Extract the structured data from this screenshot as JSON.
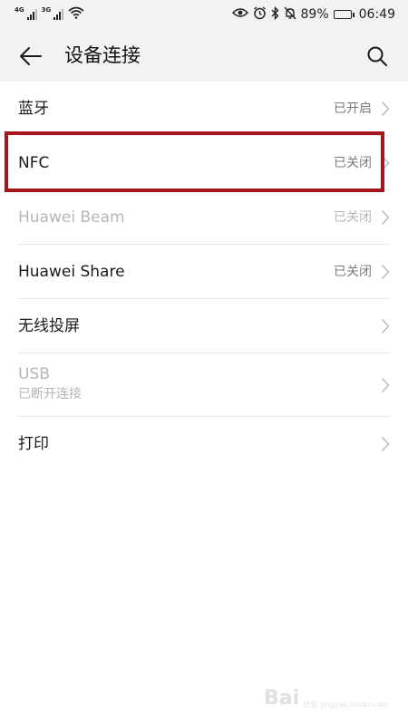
{
  "status_bar": {
    "net1": "4G",
    "net2": "3G",
    "battery": "89%",
    "time": "06:49"
  },
  "header": {
    "title": "设备连接"
  },
  "rows": [
    {
      "label": "蓝牙",
      "status": "已开启",
      "enabled": true
    },
    {
      "label": "NFC",
      "status": "已关闭",
      "enabled": true,
      "highlighted": true
    },
    {
      "label": "Huawei Beam",
      "status": "已关闭",
      "enabled": false
    },
    {
      "label": "Huawei Share",
      "status": "已关闭",
      "enabled": true
    },
    {
      "label": "无线投屏",
      "status": "",
      "enabled": true
    },
    {
      "label": "USB",
      "sublabel": "已断开连接",
      "enabled": false
    },
    {
      "label": "打印",
      "status": "",
      "enabled": true
    }
  ],
  "watermark": {
    "logo": "Bai",
    "tail": "经验",
    "url": "jingyan.baidu.com"
  },
  "colors": {
    "highlight": "#a5161c",
    "header_bg": "#f2f2f2",
    "disabled_text": "#b5b5b5"
  }
}
